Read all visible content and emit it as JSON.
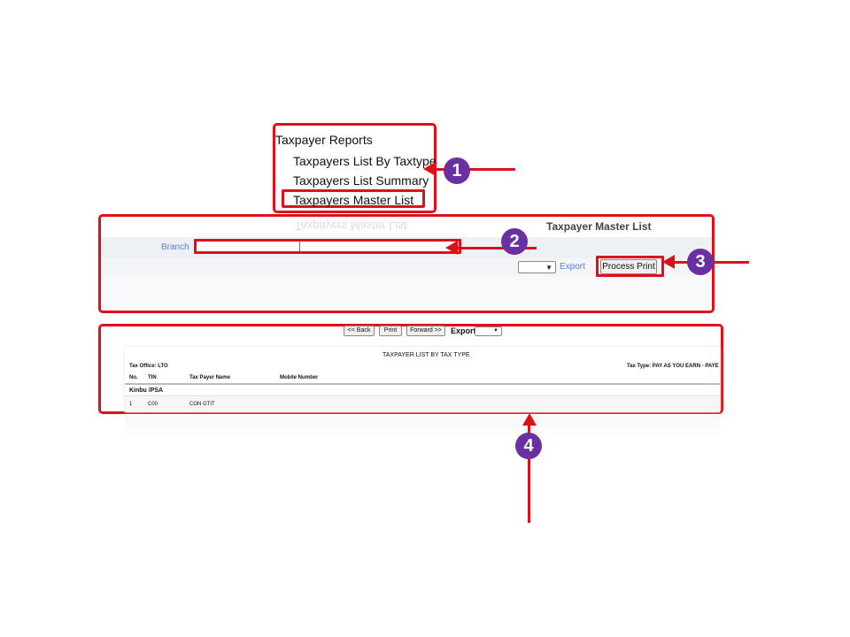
{
  "menu": {
    "title": "Taxpayer Reports",
    "items": [
      {
        "label": "Taxpayers List By Taxtype"
      },
      {
        "label": "Taxpayers List Summary"
      },
      {
        "label": "Taxpayers Master List"
      }
    ],
    "reflection_label": "Taxpayers Master List"
  },
  "form": {
    "title": "Taxpayer Master List",
    "branch_label": "Branch",
    "branch_value": "",
    "export_label": "Export",
    "export_value": "",
    "process_button": "Process Print"
  },
  "report": {
    "toolbar": {
      "back": "<< Back",
      "print": "Print",
      "forward": "Forward >>",
      "export_label": "Export"
    },
    "title": "TAXPAYER LIST BY TAX TYPE",
    "tax_office": "Tax Office: LTO",
    "tax_type": "Tax Type: PAY AS YOU EARN - PAYE",
    "columns": [
      "No.",
      "TIN",
      "Tax Payer Name",
      "Mobile Number"
    ],
    "group": "Kinbu /PSA",
    "rows": [
      {
        "no": "1",
        "tin": "C00",
        "name": "CON GTIT",
        "mobile": ""
      }
    ]
  },
  "callouts": [
    "1",
    "2",
    "3",
    "4"
  ],
  "colors": {
    "annotation_red": "#e0101a",
    "badge_purple": "#6a2fa0",
    "link_blue": "#5b7fd6"
  }
}
